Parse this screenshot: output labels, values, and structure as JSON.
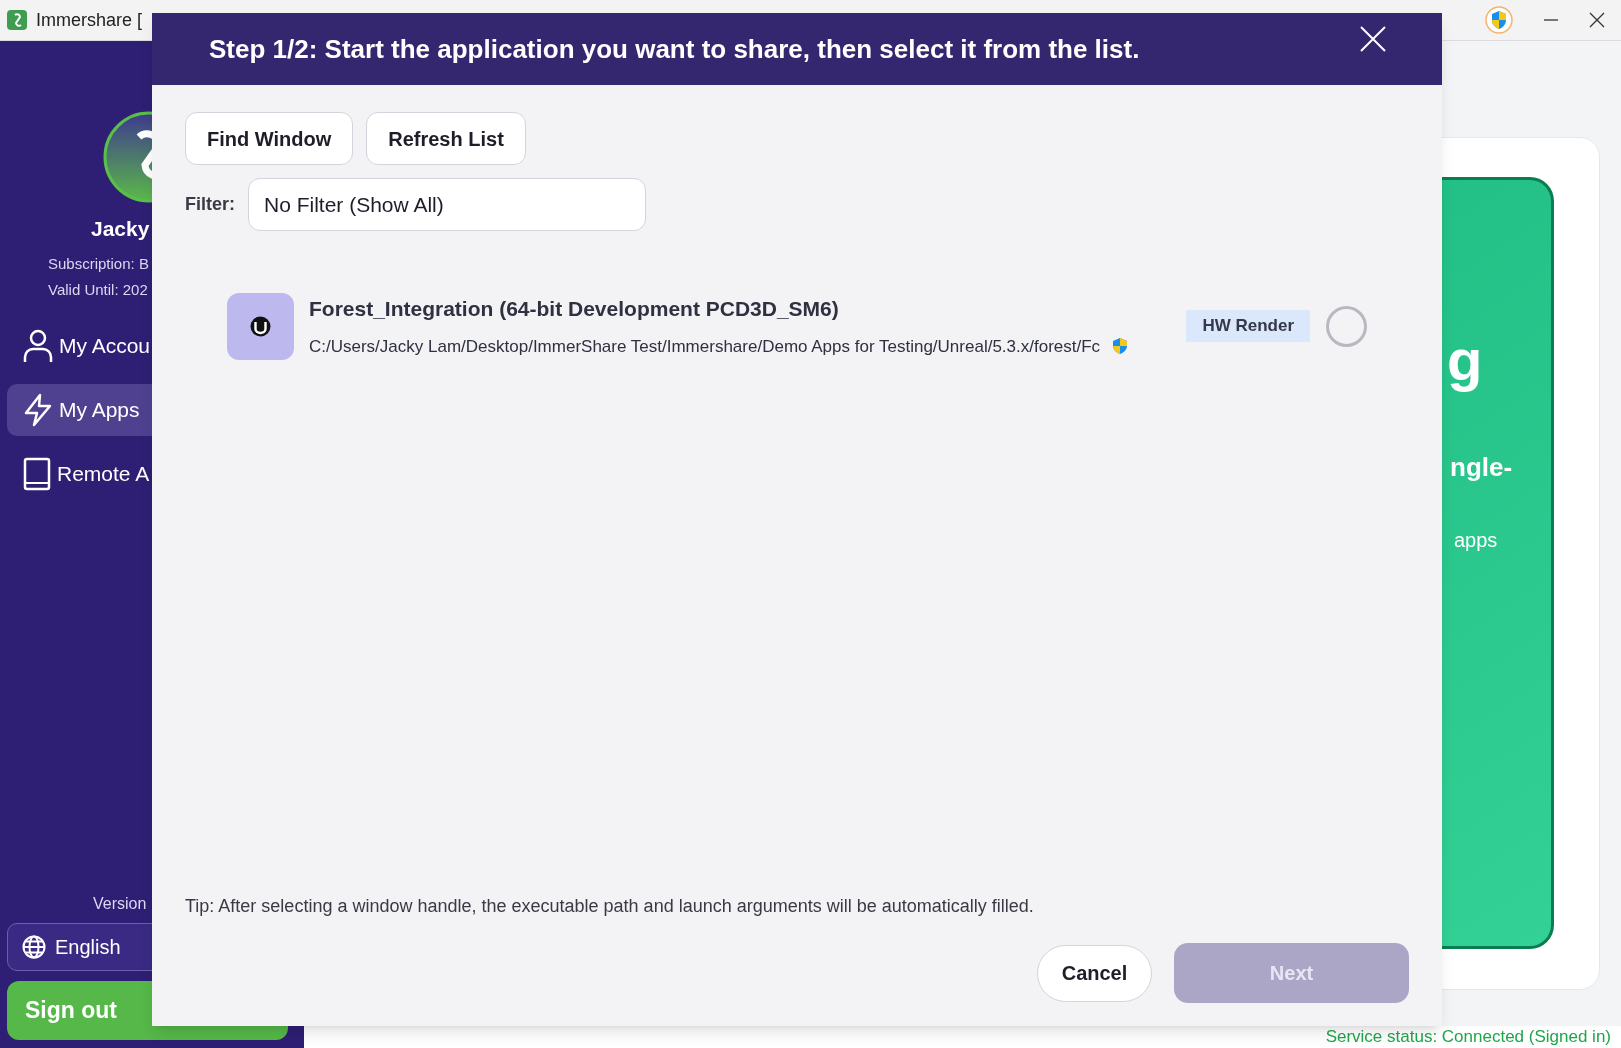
{
  "titlebar": {
    "title": "Immershare ["
  },
  "sidebar": {
    "user_name": "Jacky",
    "subscription": "Subscription: B",
    "valid_until": "Valid Until: 202",
    "nav": [
      {
        "kind": "person",
        "label": "My Accou",
        "selected": false
      },
      {
        "kind": "bolt",
        "label": "My Apps",
        "selected": true
      },
      {
        "kind": "book",
        "label": "Remote A",
        "selected": false
      }
    ],
    "version": "Version",
    "language": "English",
    "sign_out": "Sign out"
  },
  "main_card": {
    "texts": [
      {
        "kind": "headline",
        "text": "g"
      },
      {
        "kind": "subheading",
        "text": "ngle-"
      },
      {
        "kind": "body",
        "text": "apps"
      }
    ]
  },
  "status_bar": "Service status: Connected (Signed in)",
  "dialog": {
    "title": "Step 1/2: Start the application you want to share, then select it from the list.",
    "buttons": [
      "Find Window",
      "Refresh List"
    ],
    "filter": {
      "label": "Filter:",
      "value": "No Filter (Show All)"
    },
    "apps": [
      {
        "name": "Forest_Integration (64-bit Development PCD3D_SM6)",
        "path": "C:/Users/Jacky Lam/Desktop/ImmerShare Test/Immershare/Demo Apps for Testing/Unreal/5.3.x/forest/Fc",
        "admin": true,
        "badge": "HW Render",
        "selected": false
      }
    ],
    "tip": "Tip: After selecting a window handle, the executable path and launch arguments will be automatically filled.",
    "cancel": "Cancel",
    "next": {
      "label": "Next",
      "disabled": true
    }
  }
}
